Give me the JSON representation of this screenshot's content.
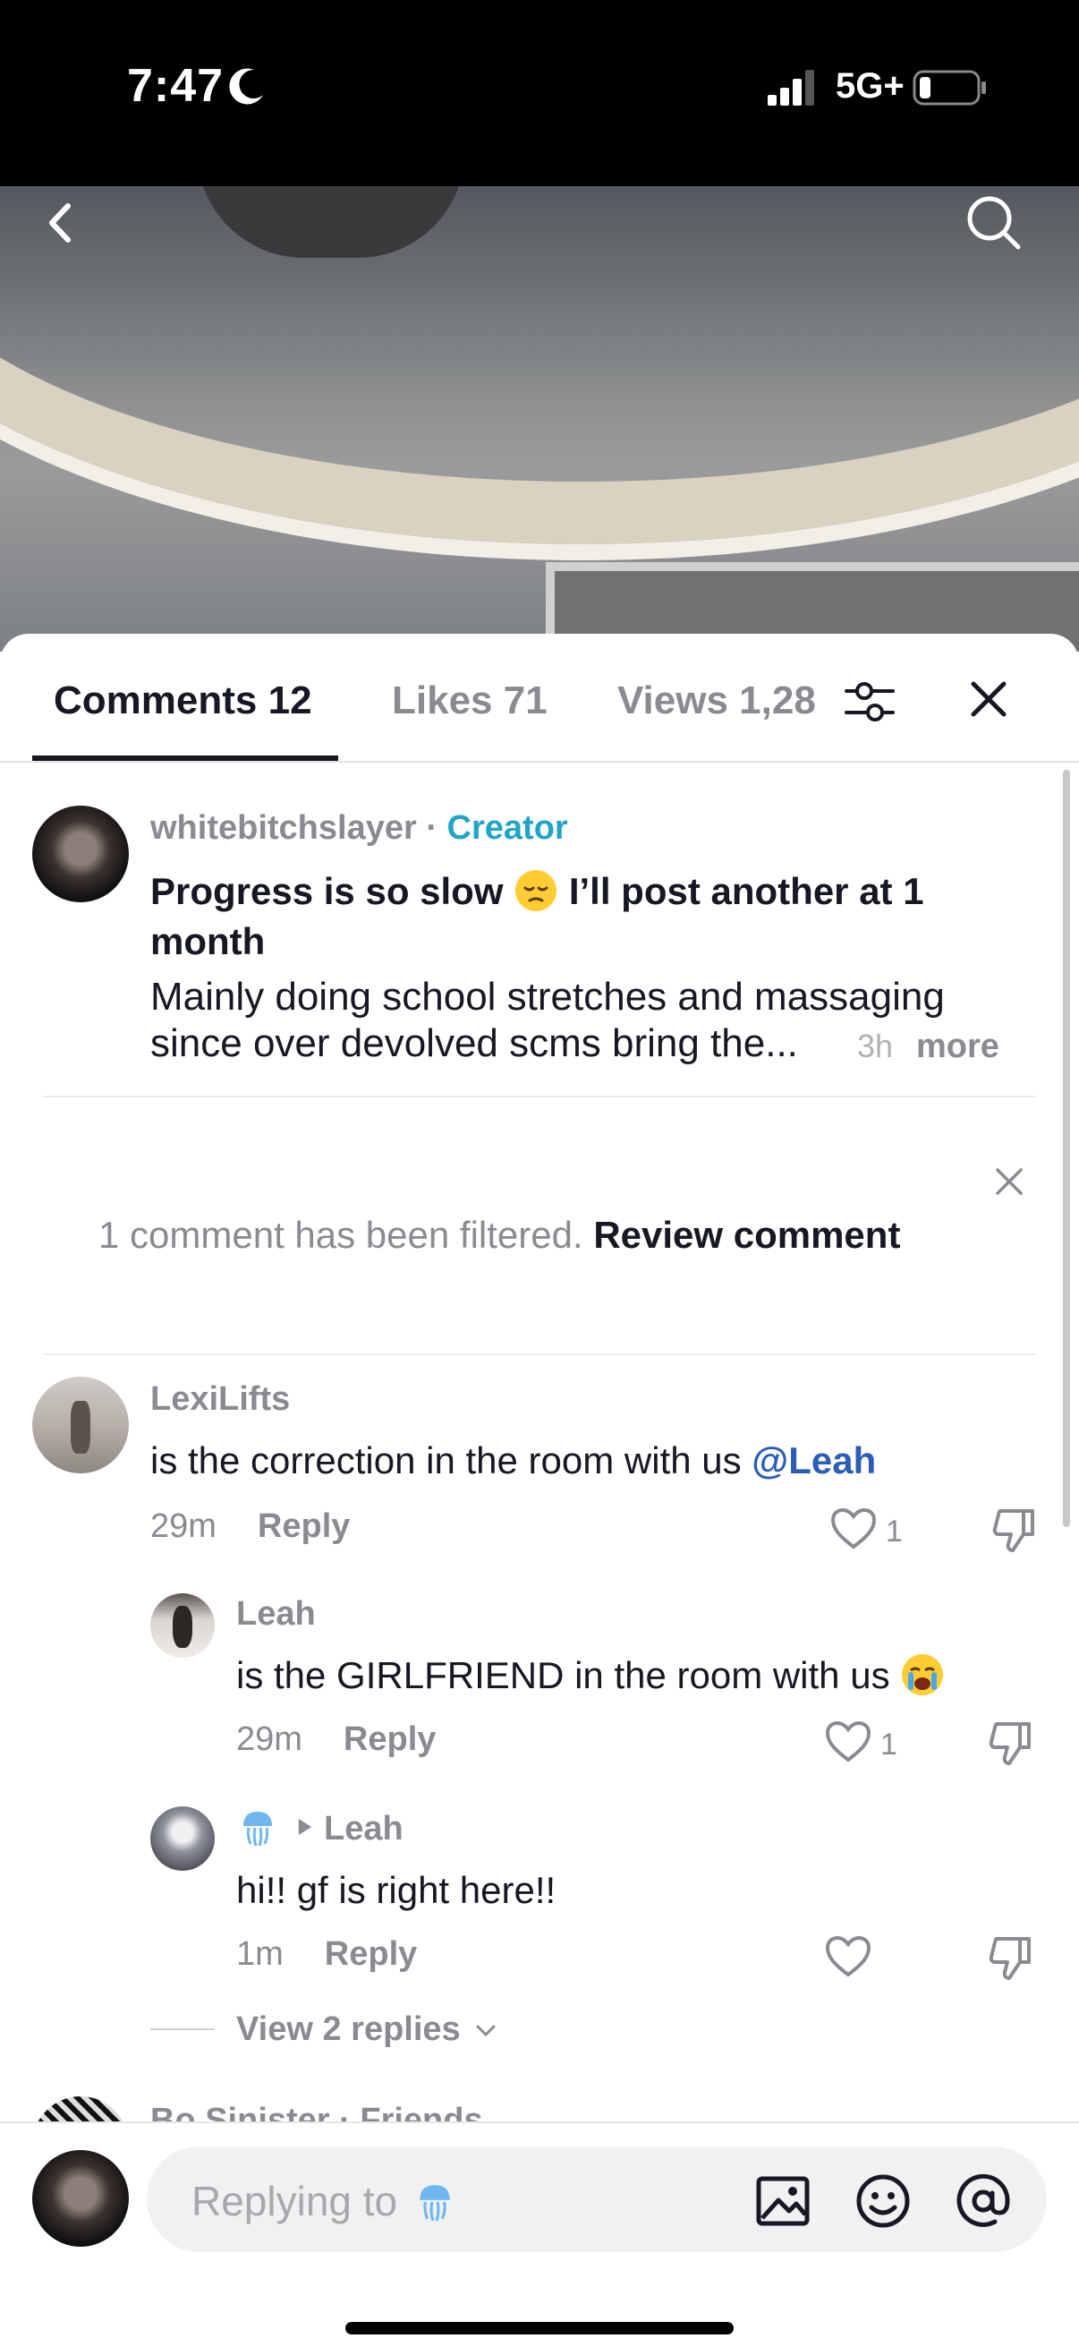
{
  "status_bar": {
    "time": "7:47",
    "network": "5G+"
  },
  "tabs": [
    {
      "label": "Comments 12"
    },
    {
      "label": "Likes 71"
    },
    {
      "label": "Views 1,28"
    }
  ],
  "comments": [
    {
      "username": "whitebitchslayer",
      "separator": " · ",
      "badge": "Creator",
      "text_bold_1": "Progress is so slow",
      "text_bold_2": " I’ll post another at 1 month",
      "text_body": "Mainly doing school stretches and massaging since over devolved scms bring the...",
      "time": "3h",
      "more": "more"
    },
    {
      "username": "LexiLifts",
      "text": "is the correction in the room with us ",
      "mention": "@Leah",
      "time": "29m",
      "reply": "Reply",
      "likes": "1"
    },
    {
      "username": "Leah",
      "text": "is the GIRLFRIEND in the room with us",
      "time": "29m",
      "reply": "Reply",
      "likes": "1"
    },
    {
      "username": "Leah",
      "text": "hi!! gf is right here!!",
      "time": "1m",
      "reply": "Reply"
    }
  ],
  "filtered_notice": {
    "text": "1 comment has been filtered. ",
    "action": "Review comment"
  },
  "view_replies": "View 2 replies",
  "peek_comment": "Bo Sinister · Friends",
  "input": {
    "placeholder": "Replying to"
  },
  "icons": [
    "back-icon",
    "search-icon",
    "filter-icon",
    "close-icon",
    "heart-icon",
    "dislike-icon",
    "image-icon",
    "emoji-icon",
    "mention-icon",
    "jellyfish-emoji"
  ]
}
